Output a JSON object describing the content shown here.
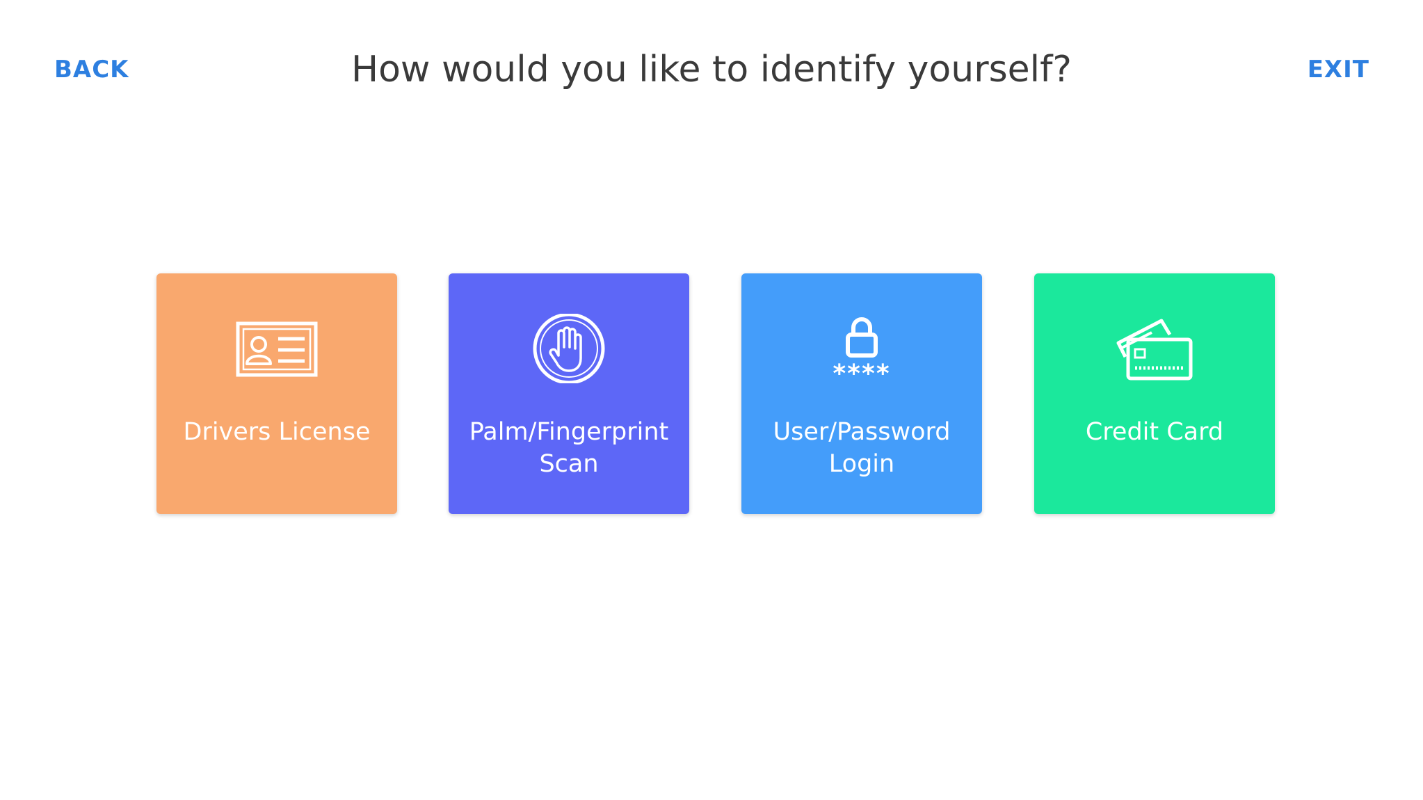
{
  "header": {
    "back_label": "BACK",
    "title": "How would you like to identify yourself?",
    "exit_label": "EXIT"
  },
  "colors": {
    "accent": "#2d7fe0",
    "title": "#3a3a3a"
  },
  "options": [
    {
      "label": "Drivers License",
      "icon": "id-card-icon",
      "color": "#f9a86e"
    },
    {
      "label": "Palm/Fingerprint\nScan",
      "icon": "hand-icon",
      "color": "#5d67f7"
    },
    {
      "label": "User/Password\nLogin",
      "icon": "lock-icon",
      "color": "#449dfa"
    },
    {
      "label": "Credit Card",
      "icon": "credit-card-icon",
      "color": "#1be89c"
    }
  ],
  "lock_icon_text": "****"
}
